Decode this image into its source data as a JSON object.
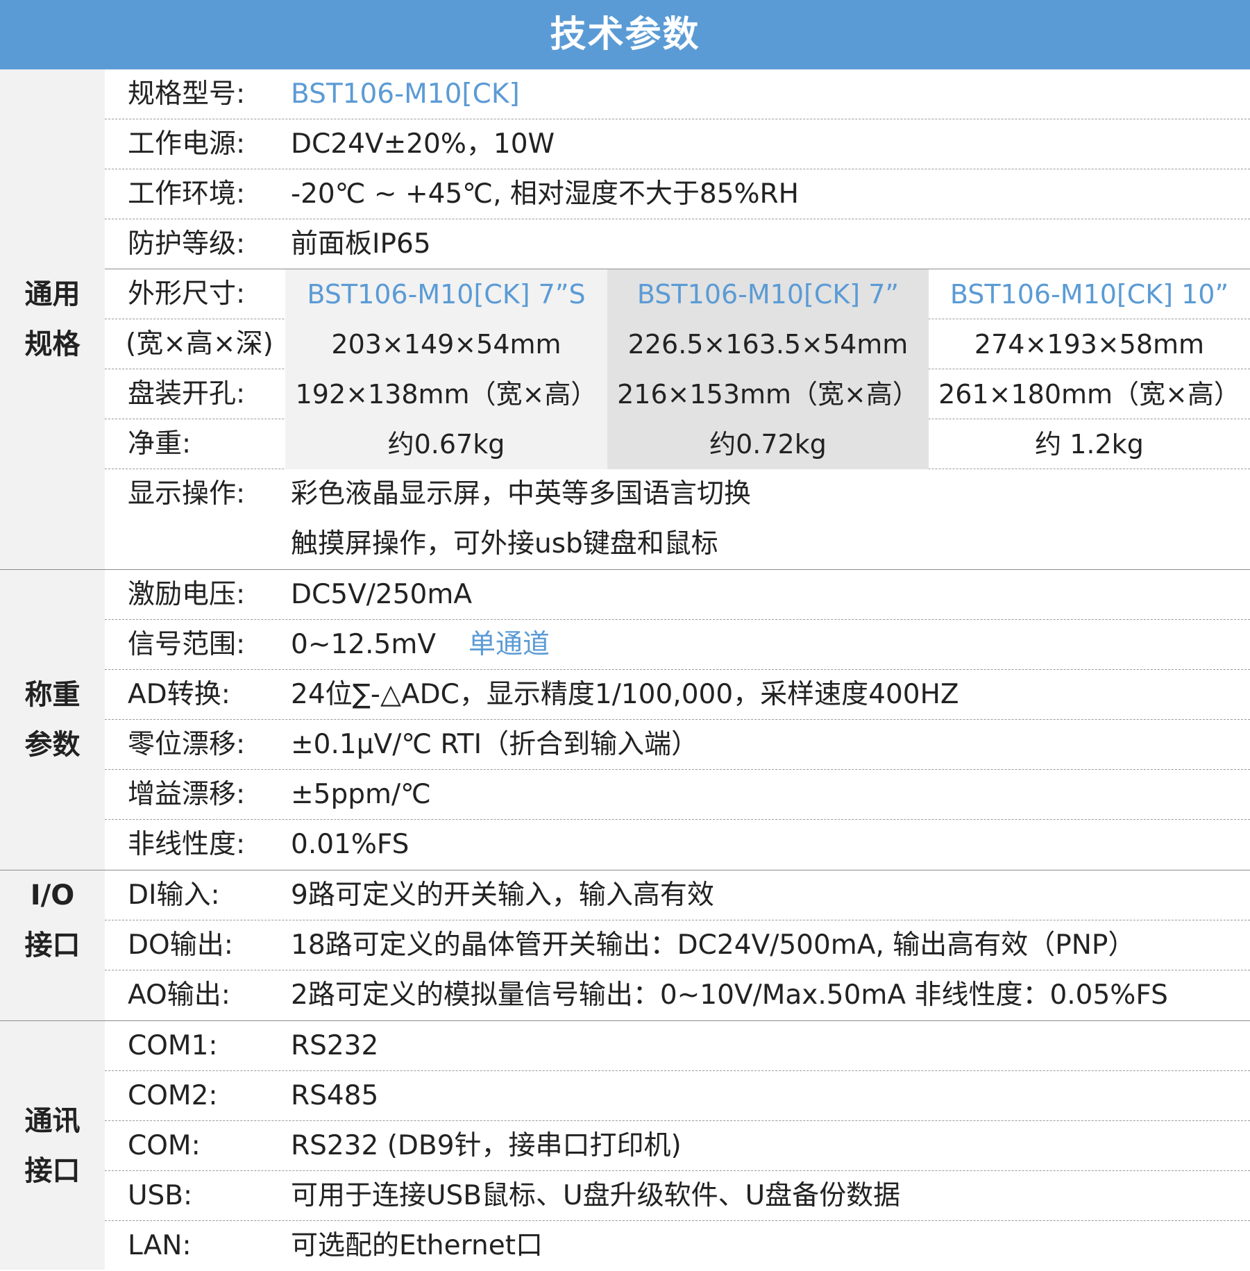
{
  "header": {
    "title": "技术参数"
  },
  "general": {
    "title_line1": "通用",
    "title_line2": "规格",
    "model_label": "规格型号:",
    "model_value": "BST106-M10[CK]",
    "power_label": "工作电源:",
    "power_value": "DC24V±20%，10W",
    "env_label": "工作环境:",
    "env_value": "-20℃ ~ +45℃, 相对湿度不大于85%RH",
    "protect_label": "防护等级:",
    "protect_value": "前面板IP65",
    "shape_label": "外形尺寸:",
    "shape_models": [
      "BST106-M10[CK]  7”S",
      "BST106-M10[CK]  7”",
      "BST106-M10[CK]  10”"
    ],
    "dim_label": "(宽×高×深)",
    "dims": [
      "203×149×54mm",
      "226.5×163.5×54mm",
      "274×193×58mm"
    ],
    "cutout_label": "盘装开孔:",
    "cutouts": [
      "192×138mm（宽×高）",
      "216×153mm（宽×高）",
      "261×180mm（宽×高）"
    ],
    "weight_label": "净重:",
    "weights": [
      "约0.67kg",
      "约0.72kg",
      "约 1.2kg"
    ],
    "display_label": "显示操作:",
    "display_value_1": "彩色液晶显示屏，中英等多国语言切换",
    "display_value_2": "触摸屏操作，可外接usb键盘和鼠标"
  },
  "weighing": {
    "title_line1": "称重",
    "title_line2": "参数",
    "rows": [
      {
        "label": "激励电压:",
        "value": "DC5V/250mA",
        "extra": ""
      },
      {
        "label": "信号范围:",
        "value": "0~12.5mV",
        "extra": "单通道"
      },
      {
        "label": "AD转换:",
        "value": "24位∑-△ADC，显示精度1/100,000，采样速度400HZ",
        "extra": ""
      },
      {
        "label": "零位漂移:",
        "value": "±0.1μV/℃ RTI（折合到输入端）",
        "extra": ""
      },
      {
        "label": "增益漂移:",
        "value": "±5ppm/℃",
        "extra": ""
      },
      {
        "label": "非线性度:",
        "value": "0.01%FS",
        "extra": ""
      }
    ]
  },
  "io": {
    "title_line1": "I/O",
    "title_line2": "接口",
    "rows": [
      {
        "label": "DI输入:",
        "value": "9路可定义的开关输入，输入高有效"
      },
      {
        "label": "DO输出:",
        "value": "18路可定义的晶体管开关输出：DC24V/500mA, 输出高有效（PNP）"
      },
      {
        "label": "AO输出:",
        "value": "2路可定义的模拟量信号输出：0~10V/Max.50mA   非线性度：0.05%FS"
      }
    ]
  },
  "comm": {
    "title_line1": "通讯",
    "title_line2": "接口",
    "rows": [
      {
        "label": "COM1:",
        "value": "RS232"
      },
      {
        "label": "COM2:",
        "value": "RS485"
      },
      {
        "label": "COM:",
        "value": "RS232 (DB9针，接串口打印机)"
      },
      {
        "label": "USB:",
        "value": "可用于连接USB鼠标、U盘升级软件、U盘备份数据"
      },
      {
        "label": "LAN:",
        "value": "可选配的Ethernet口"
      }
    ]
  },
  "colors": {
    "header_bg": "#5b9bd5",
    "accent": "#5b9bd5",
    "side_bg": "#f2f2f2"
  }
}
